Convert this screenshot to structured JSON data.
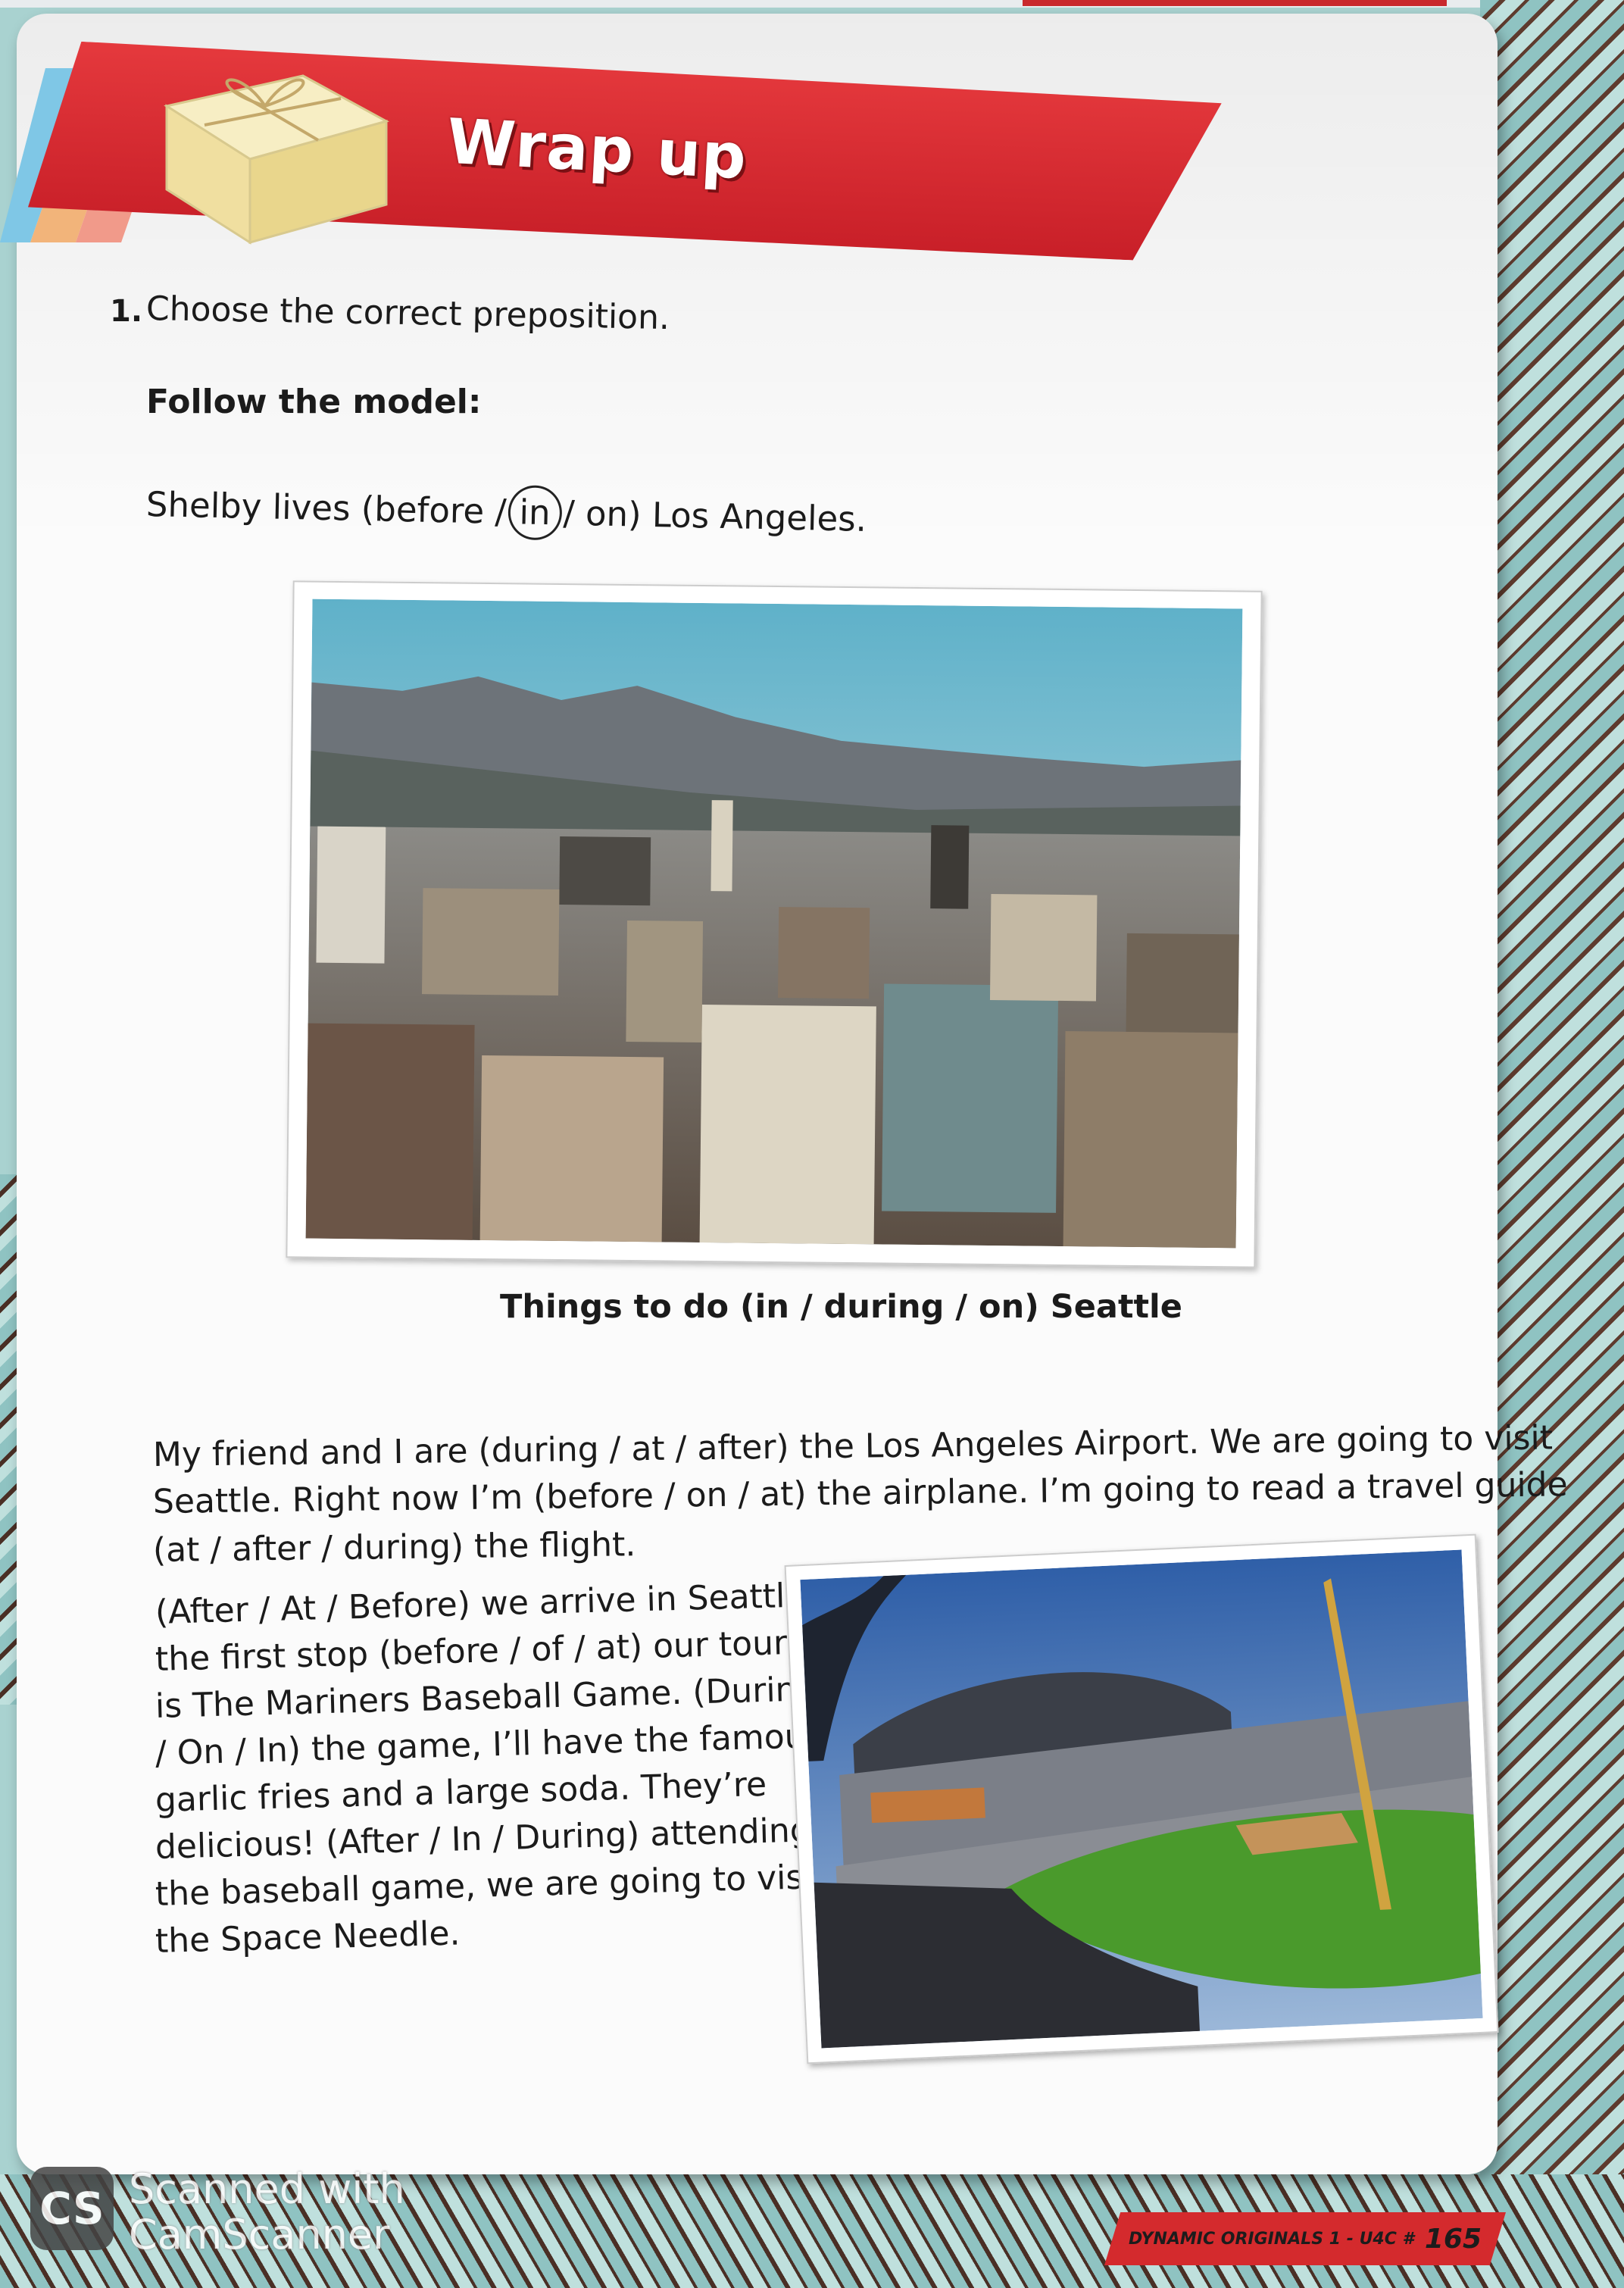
{
  "banner": {
    "title": "Wrap up"
  },
  "exercise": {
    "number": "1.",
    "instruction": "Choose the correct preposition.",
    "model_label": "Follow the model:",
    "model_sentence": {
      "before": "Shelby lives (before /",
      "circled": "in",
      "after": "/ on) Los Angeles."
    },
    "caption": "Things to do (in / during / on) Seattle",
    "paragraph1": [
      "My friend and I are (during / at / after) the Los Angeles Airport. We are going to visit",
      "Seattle. Right now I’m (before / on / at) the airplane. I’m going to read a travel guide",
      "(at / after / during) the flight."
    ],
    "paragraph2": [
      "(After / At / Before) we arrive in Seattle,",
      "the first stop (before / of / at) our tour",
      "is The Mariners Baseball Game. (During",
      "/ On / In) the game, I’ll have the famous",
      "garlic  fries  and  a  large  soda.  They’re",
      "delicious! (After / In / During) attending",
      "the baseball game, we are going to visit",
      "the Space Needle."
    ]
  },
  "footer": {
    "series": "DYNAMIC ORIGINALS 1 - U4C #",
    "page_number": "165"
  },
  "watermark": {
    "logo": "CS",
    "line1": "Scanned with",
    "line2": "CamScanner"
  },
  "colors": {
    "banner_red": "#d62a2e",
    "rope_teal": "#8fc3c2",
    "rope_brown": "#4a2f25"
  }
}
